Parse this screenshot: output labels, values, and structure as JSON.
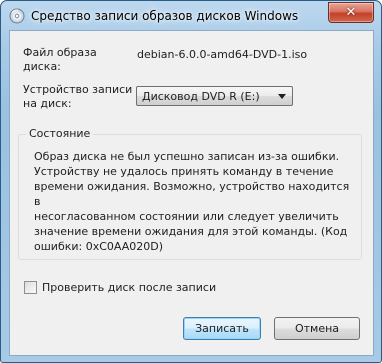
{
  "window": {
    "title": "Средство записи образов дисков Windows",
    "close_symbol": "✕",
    "icon": "disc-burner-icon"
  },
  "form": {
    "file_label_line1": "Файл образа",
    "file_label_line2": "диска:",
    "file_value": "debian-6.0.0-amd64-DVD-1.iso",
    "device_label_line1": "Устройство записи",
    "device_label_line2": "на диск:",
    "device_selected": "Дисковод DVD R (E:)"
  },
  "status": {
    "legend": "Состояние",
    "line1": "Образ диска не был успешно записан из-за ошибки.",
    "line2": "Устройству не удалось принять команду в течение",
    "line3": "времени ожидания. Возможно, устройство находится в",
    "line4": "несогласованном состоянии или следует увеличить",
    "line5": "значение времени ожидания для этой команды. (Код",
    "line6": "ошибки: 0xC0AA020D)"
  },
  "verify": {
    "label": "Проверить диск после записи",
    "checked": false
  },
  "buttons": {
    "burn": "Записать",
    "cancel": "Отмена"
  }
}
